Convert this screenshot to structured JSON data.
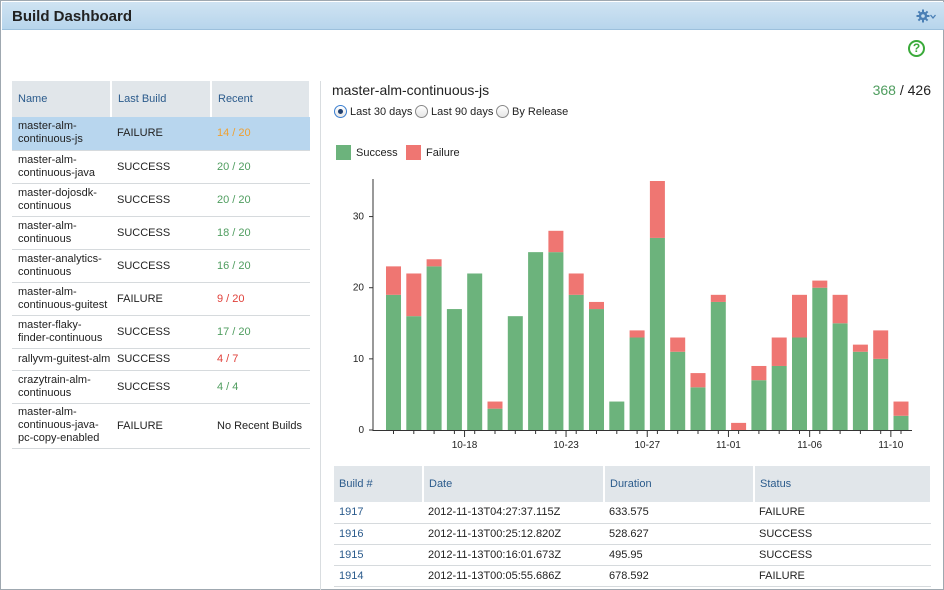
{
  "header": {
    "title": "Build Dashboard",
    "gear_icon": "gear-icon",
    "help_icon": "help-icon",
    "help_glyph": "?"
  },
  "builds_table": {
    "columns": [
      "Name",
      "Last Build",
      "Recent"
    ],
    "rows": [
      {
        "name": "master-alm-continuous-js",
        "last_build": "FAILURE",
        "recent": "14 / 20",
        "recent_color": "orange",
        "selected": true
      },
      {
        "name": "master-alm-continuous-java",
        "last_build": "SUCCESS",
        "recent": "20 / 20",
        "recent_color": "green"
      },
      {
        "name": "master-dojosdk-continuous",
        "last_build": "SUCCESS",
        "recent": "20 / 20",
        "recent_color": "green"
      },
      {
        "name": "master-alm-continuous",
        "last_build": "SUCCESS",
        "recent": "18 / 20",
        "recent_color": "green"
      },
      {
        "name": "master-analytics-continuous",
        "last_build": "SUCCESS",
        "recent": "16 / 20",
        "recent_color": "green"
      },
      {
        "name": "master-alm-continuous-guitest",
        "last_build": "FAILURE",
        "recent": "9 / 20",
        "recent_color": "red"
      },
      {
        "name": "master-flaky-finder-continuous",
        "last_build": "SUCCESS",
        "recent": "17 / 20",
        "recent_color": "green"
      },
      {
        "name": "rallyvm-guitest-alm",
        "last_build": "SUCCESS",
        "recent": "4 / 7",
        "recent_color": "red"
      },
      {
        "name": "crazytrain-alm-continuous",
        "last_build": "SUCCESS",
        "recent": "4 / 4",
        "recent_color": "green"
      },
      {
        "name": "master-alm-continuous-java-pc-copy-enabled",
        "last_build": "FAILURE",
        "recent": "No Recent Builds",
        "recent_color": "plain"
      }
    ]
  },
  "detail": {
    "job_name": "master-alm-continuous-js",
    "pass_count": "368",
    "separator": " / ",
    "total_count": "426",
    "range_options": [
      {
        "label": "Last 30 days",
        "selected": true
      },
      {
        "label": "Last 90 days",
        "selected": false
      },
      {
        "label": "By Release",
        "selected": false
      }
    ]
  },
  "colors": {
    "success": "#6cb37c",
    "failure": "#ef7672",
    "accent": "#2b5b8c"
  },
  "chart_data": {
    "type": "bar",
    "stacked": true,
    "legend": [
      "Success",
      "Failure"
    ],
    "legend_position": "top-left",
    "ylim": [
      0,
      35
    ],
    "y_ticks": [
      0,
      10,
      20,
      30
    ],
    "x_tick_labels": [
      "10-18",
      "10-23",
      "10-27",
      "11-01",
      "11-06",
      "11-10"
    ],
    "x_tick_at_bar": [
      3,
      8,
      12,
      16,
      20,
      24
    ],
    "series": [
      {
        "name": "Success",
        "values": [
          19,
          16,
          23,
          17,
          22,
          3,
          16,
          25,
          25,
          19,
          17,
          4,
          13,
          27,
          11,
          6,
          18,
          0,
          7,
          9,
          13,
          20,
          15,
          11,
          10,
          2
        ]
      },
      {
        "name": "Failure",
        "values": [
          4,
          6,
          1,
          0,
          0,
          1,
          0,
          0,
          3,
          3,
          1,
          0,
          1,
          8,
          2,
          2,
          1,
          1,
          2,
          4,
          6,
          1,
          4,
          1,
          4,
          2
        ]
      }
    ]
  },
  "history_table": {
    "columns": [
      "Build #",
      "Date",
      "Duration",
      "Status"
    ],
    "rows": [
      {
        "build": "1917",
        "date": "2012-11-13T04:27:37.115Z",
        "duration": "633.575",
        "status": "FAILURE"
      },
      {
        "build": "1916",
        "date": "2012-11-13T00:25:12.820Z",
        "duration": "528.627",
        "status": "SUCCESS"
      },
      {
        "build": "1915",
        "date": "2012-11-13T00:16:01.673Z",
        "duration": "495.95",
        "status": "SUCCESS"
      },
      {
        "build": "1914",
        "date": "2012-11-13T00:05:55.686Z",
        "duration": "678.592",
        "status": "FAILURE"
      }
    ]
  }
}
